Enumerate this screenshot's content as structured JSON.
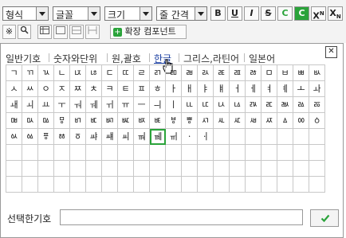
{
  "toolbar": {
    "format_select": "형식",
    "font_select": "글꼴",
    "size_select": "크기",
    "linespacing_select": "줄 간격",
    "bold": "B",
    "underline": "U",
    "italic": "I",
    "strike": "S",
    "color_text": "C",
    "color_bg": "C",
    "superscript": "X",
    "subscript": "X",
    "special_char": "※",
    "search": "🔍",
    "extension_button": "확장 컴포넌트",
    "accent_green": "#2aa33a"
  },
  "tabs": [
    "일반기호",
    "숫자와단위",
    "원,괄호",
    "한글",
    "그리스,라틴어",
    "일본어"
  ],
  "active_tab": "한글",
  "close_label": "✕",
  "grid": {
    "rows": [
      [
        "ㄱ",
        "ㄲ",
        "ㄳ",
        "ㄴ",
        "ㄵ",
        "ㄶ",
        "ㄷ",
        "ㄸ",
        "ㄹ",
        "ㄺ",
        "ㄻ",
        "ㄼ",
        "ㄽ",
        "ㄾ",
        "ㄿ",
        "ㅀ",
        "ㅁ",
        "ㅂ",
        "ㅃ",
        "ㅄ"
      ],
      [
        "ㅅ",
        "ㅆ",
        "ㅇ",
        "ㅈ",
        "ㅉ",
        "ㅊ",
        "ㅋ",
        "ㅌ",
        "ㅍ",
        "ㅎ",
        "ㅏ",
        "ㅐ",
        "ㅑ",
        "ㅒ",
        "ㅓ",
        "ㅔ",
        "ㅕ",
        "ㅖ",
        "ㅗ",
        "ㅘ"
      ],
      [
        "ㅙ",
        "ㅚ",
        "ㅛ",
        "ㅜ",
        "ㅝ",
        "ㅞ",
        "ㅟ",
        "ㅠ",
        "ㅡ",
        "ㅢ",
        "ㅣ",
        "ㅥ",
        "ㅦ",
        "ㅧ",
        "ㅨ",
        "ㅩ",
        "ㅪ",
        "ㅫ",
        "ㅬ",
        "ㅭ"
      ],
      [
        "ㅮ",
        "ㅯ",
        "ㅰ",
        "ㅱ",
        "ㅲ",
        "ㅳ",
        "ㅴ",
        "ㅵ",
        "ㅶ",
        "ㅷ",
        "ㅸ",
        "ㅹ",
        "ㅺ",
        "ㅻ",
        "ㅼ",
        "ㅽ",
        "ㅾ",
        "ㅿ",
        "ㆀ",
        "ㆁ"
      ],
      [
        "ㆂ",
        "ㆃ",
        "ㆄ",
        "ㆅ",
        "ㆆ",
        "ㆇ",
        "ㆈ",
        "ㆉ",
        "ㆊ",
        "ㆋ",
        "ㆌ",
        "ㆍ",
        "ㆎ",
        "",
        "",
        "",
        "",
        "",
        "",
        ""
      ],
      [
        "",
        "",
        "",
        "",
        "",
        "",
        "",
        "",
        "",
        "",
        "",
        "",
        "",
        "",
        "",
        "",
        "",
        "",
        "",
        ""
      ],
      [
        "",
        "",
        "",
        "",
        "",
        "",
        "",
        "",
        "",
        "",
        "",
        "",
        "",
        "",
        "",
        "",
        "",
        "",
        "",
        ""
      ],
      [
        "",
        "",
        "",
        "",
        "",
        "",
        "",
        "",
        "",
        "",
        "",
        "",
        "",
        "",
        "",
        "",
        "",
        "",
        "",
        ""
      ]
    ],
    "selected_row": 4,
    "selected_col": 9
  },
  "bottom": {
    "label": "선택한기호",
    "input_value": "",
    "ok_icon": "check-icon"
  }
}
